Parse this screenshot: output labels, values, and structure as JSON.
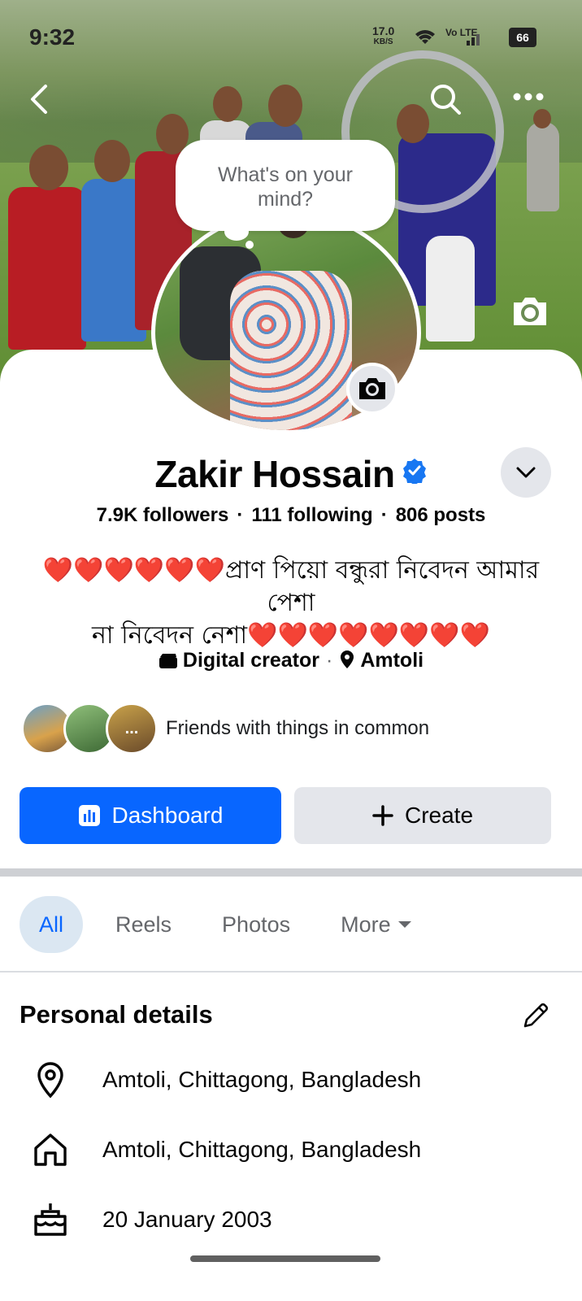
{
  "status_bar": {
    "time": "9:32",
    "net_speed": "17.0",
    "net_unit": "KB/S",
    "volte": "Vo LTE",
    "battery": "66"
  },
  "composer_bubble": {
    "placeholder": "What's on your mind?"
  },
  "profile": {
    "name": "Zakir Hossain",
    "verified": true,
    "followers": "7.9K followers",
    "following": "111 following",
    "posts": "806 posts",
    "bio_line1_hearts": "❤️❤️❤️❤️❤️❤️",
    "bio_line1_text": "প্রাণ পিয়ো বন্ধুরা নিবেদন আমার পেশা",
    "bio_line2_text": "না নিবেদন নেশা",
    "bio_line2_hearts": "❤️❤️❤️❤️❤️❤️❤️❤️",
    "category": "Digital creator",
    "location": "Amtoli",
    "friends_text": "Friends with things in common",
    "friends_more": "..."
  },
  "actions": {
    "dashboard_label": "Dashboard",
    "create_label": "Create"
  },
  "tabs": [
    {
      "label": "All",
      "active": true
    },
    {
      "label": "Reels",
      "active": false
    },
    {
      "label": "Photos",
      "active": false
    },
    {
      "label": "More",
      "active": false
    }
  ],
  "personal_details": {
    "title": "Personal details",
    "items": [
      {
        "icon": "location-pin-icon",
        "text": "Amtoli, Chittagong, Bangladesh"
      },
      {
        "icon": "home-icon",
        "text": "Amtoli, Chittagong, Bangladesh"
      },
      {
        "icon": "birthday-cake-icon",
        "text": "20 January 2003"
      }
    ]
  },
  "colors": {
    "primary_blue": "#0866ff",
    "verified_blue": "#1877f2",
    "secondary_button": "#e4e6eb",
    "active_tab_bg": "#dbe7f2",
    "heart_red": "#e0182d"
  }
}
